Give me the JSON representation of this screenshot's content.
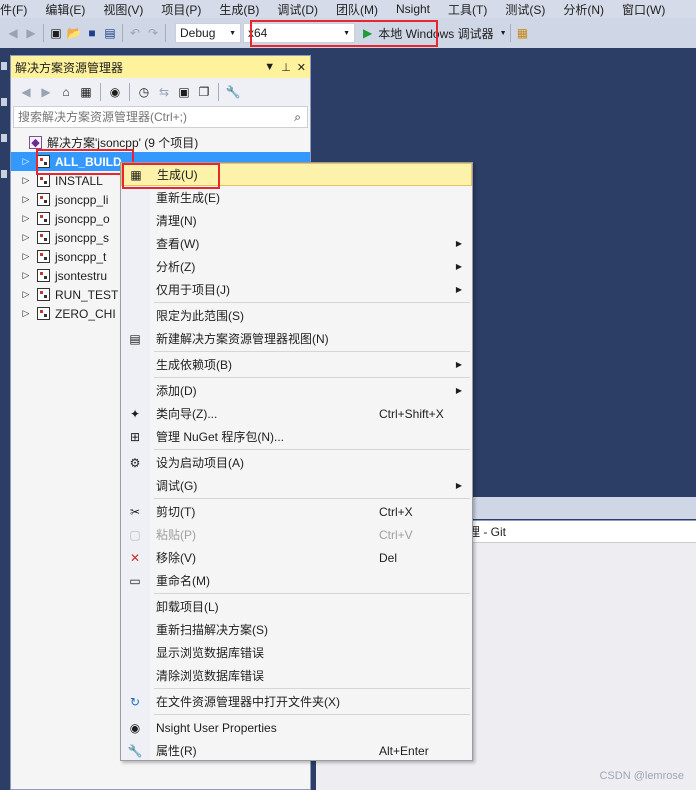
{
  "menubar": {
    "items": [
      "件(F)",
      "编辑(E)",
      "视图(V)",
      "项目(P)",
      "生成(B)",
      "调试(D)",
      "团队(M)",
      "Nsight",
      "工具(T)",
      "测试(S)",
      "分析(N)",
      "窗口(W)"
    ]
  },
  "toolbar": {
    "config": "Debug",
    "platform": "x64",
    "run_label": "本地 Windows 调试器"
  },
  "solution_explorer": {
    "title": "解决方案资源管理器",
    "search_placeholder": "搜索解决方案资源管理器(Ctrl+;)",
    "solution_label": "解决方案'jsoncpp' (9 个项目)",
    "projects": [
      {
        "label": "ALL_BUILD",
        "selected": true
      },
      {
        "label": "INSTALL"
      },
      {
        "label": "jsoncpp_li"
      },
      {
        "label": "jsoncpp_o"
      },
      {
        "label": "jsoncpp_s"
      },
      {
        "label": "jsoncpp_t"
      },
      {
        "label": "jsontestru"
      },
      {
        "label": "RUN_TEST"
      },
      {
        "label": "ZERO_CHI"
      }
    ]
  },
  "context_menu": {
    "items": [
      {
        "label": "生成(U)",
        "icon": "build-icon",
        "highlight": true
      },
      {
        "label": "重新生成(E)"
      },
      {
        "label": "清理(N)"
      },
      {
        "label": "查看(W)",
        "submenu": true
      },
      {
        "label": "分析(Z)",
        "submenu": true
      },
      {
        "label": "仅用于项目(J)",
        "submenu": true
      },
      {
        "sep": true
      },
      {
        "label": "限定为此范围(S)"
      },
      {
        "label": "新建解决方案资源管理器视图(N)",
        "icon": "new-view-icon"
      },
      {
        "sep": true
      },
      {
        "label": "生成依赖项(B)",
        "submenu": true
      },
      {
        "sep": true
      },
      {
        "label": "添加(D)",
        "submenu": true
      },
      {
        "label": "类向导(Z)...",
        "icon": "class-wizard-icon",
        "shortcut": "Ctrl+Shift+X"
      },
      {
        "label": "管理 NuGet 程序包(N)...",
        "icon": "nuget-icon"
      },
      {
        "sep": true
      },
      {
        "label": "设为启动项目(A)",
        "icon": "gear-icon"
      },
      {
        "label": "调试(G)",
        "submenu": true
      },
      {
        "sep": true
      },
      {
        "label": "剪切(T)",
        "icon": "scissors-icon",
        "shortcut": "Ctrl+X"
      },
      {
        "label": "粘贴(P)",
        "icon": "paste-icon",
        "shortcut": "Ctrl+V",
        "disabled": true
      },
      {
        "label": "移除(V)",
        "icon": "remove-icon",
        "shortcut": "Del"
      },
      {
        "label": "重命名(M)",
        "icon": "rename-icon"
      },
      {
        "sep": true
      },
      {
        "label": "卸载项目(L)"
      },
      {
        "label": "重新扫描解决方案(S)"
      },
      {
        "label": "显示浏览数据库错误"
      },
      {
        "label": "清除浏览数据库错误"
      },
      {
        "sep": true
      },
      {
        "label": "在文件资源管理器中打开文件夹(X)",
        "icon": "open-folder-icon"
      },
      {
        "sep": true
      },
      {
        "label": "Nsight User Properties",
        "icon": "nsight-icon"
      },
      {
        "label": "属性(R)",
        "icon": "wrench-icon",
        "shortcut": "Alt+Enter"
      }
    ]
  },
  "lower_panel": {
    "header": "理 - Git"
  },
  "watermark": "CSDN @lemrose",
  "colors": {
    "accent_red": "#e8262e",
    "selection_blue": "#3399ff",
    "menu_highlight": "#fcf2a9",
    "ide_background": "#2d3e66"
  }
}
